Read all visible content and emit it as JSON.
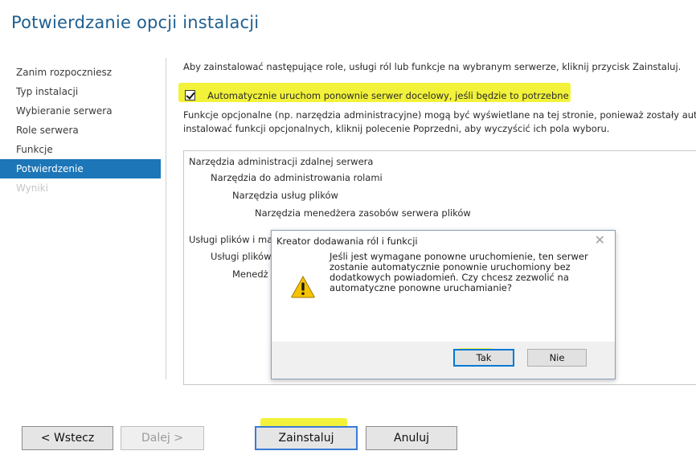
{
  "page": {
    "title": "Potwierdzanie opcji instalacji"
  },
  "nav": {
    "items": [
      {
        "label": "Zanim rozpoczniesz",
        "state": "normal"
      },
      {
        "label": "Typ instalacji",
        "state": "normal"
      },
      {
        "label": "Wybieranie serwera",
        "state": "normal"
      },
      {
        "label": "Role serwera",
        "state": "normal"
      },
      {
        "label": "Funkcje",
        "state": "normal"
      },
      {
        "label": "Potwierdzenie",
        "state": "active"
      },
      {
        "label": "Wyniki",
        "state": "disabled"
      }
    ]
  },
  "content": {
    "intro": "Aby zainstalować następujące role, usługi ról lub funkcje na wybranym serwerze, kliknij przycisk Zainstaluj.",
    "restart_checkbox_label": "Automatycznie uruchom ponownie serwer docelowy, jeśli będzie to potrzebne",
    "restart_checked": true,
    "optional_line1": "Funkcje opcjonalne (np. narzędzia administracyjne) mogą być wyświetlane na tej stronie, ponieważ zostały aut",
    "optional_line2": "instalować funkcji opcjonalnych, kliknij polecenie Poprzedni, aby wyczyścić ich pola wyboru."
  },
  "tree": {
    "items": [
      "Narzędzia administracji zdalnej serwera",
      "Narzędzia do administrowania rolami",
      "Narzędzia usług plików",
      "Narzędzia menedżera zasobów serwera plików",
      "Usługi plików i ma",
      "Usługi plików",
      "Menedż"
    ]
  },
  "dialog": {
    "title": "Kreator dodawania ról i funkcji",
    "close": "✕",
    "message": "Jeśli jest wymagane ponowne uruchomienie, ten serwer zostanie automatycznie ponownie uruchomiony bez dodatkowych powiadomień. Czy chcesz zezwolić na automatyczne ponowne uruchamianie?",
    "yes_label": "Tak",
    "no_label": "Nie",
    "icon": "warning-icon"
  },
  "footer": {
    "back_label": "< Wstecz",
    "next_label": "Dalej >",
    "install_label": "Zainstaluj",
    "cancel_label": "Anuluj"
  },
  "colors": {
    "title": "#1f5f8f",
    "nav_active": "#1c76b8",
    "highlight": "#f2f23a",
    "default_button_border": "#0078d7"
  }
}
